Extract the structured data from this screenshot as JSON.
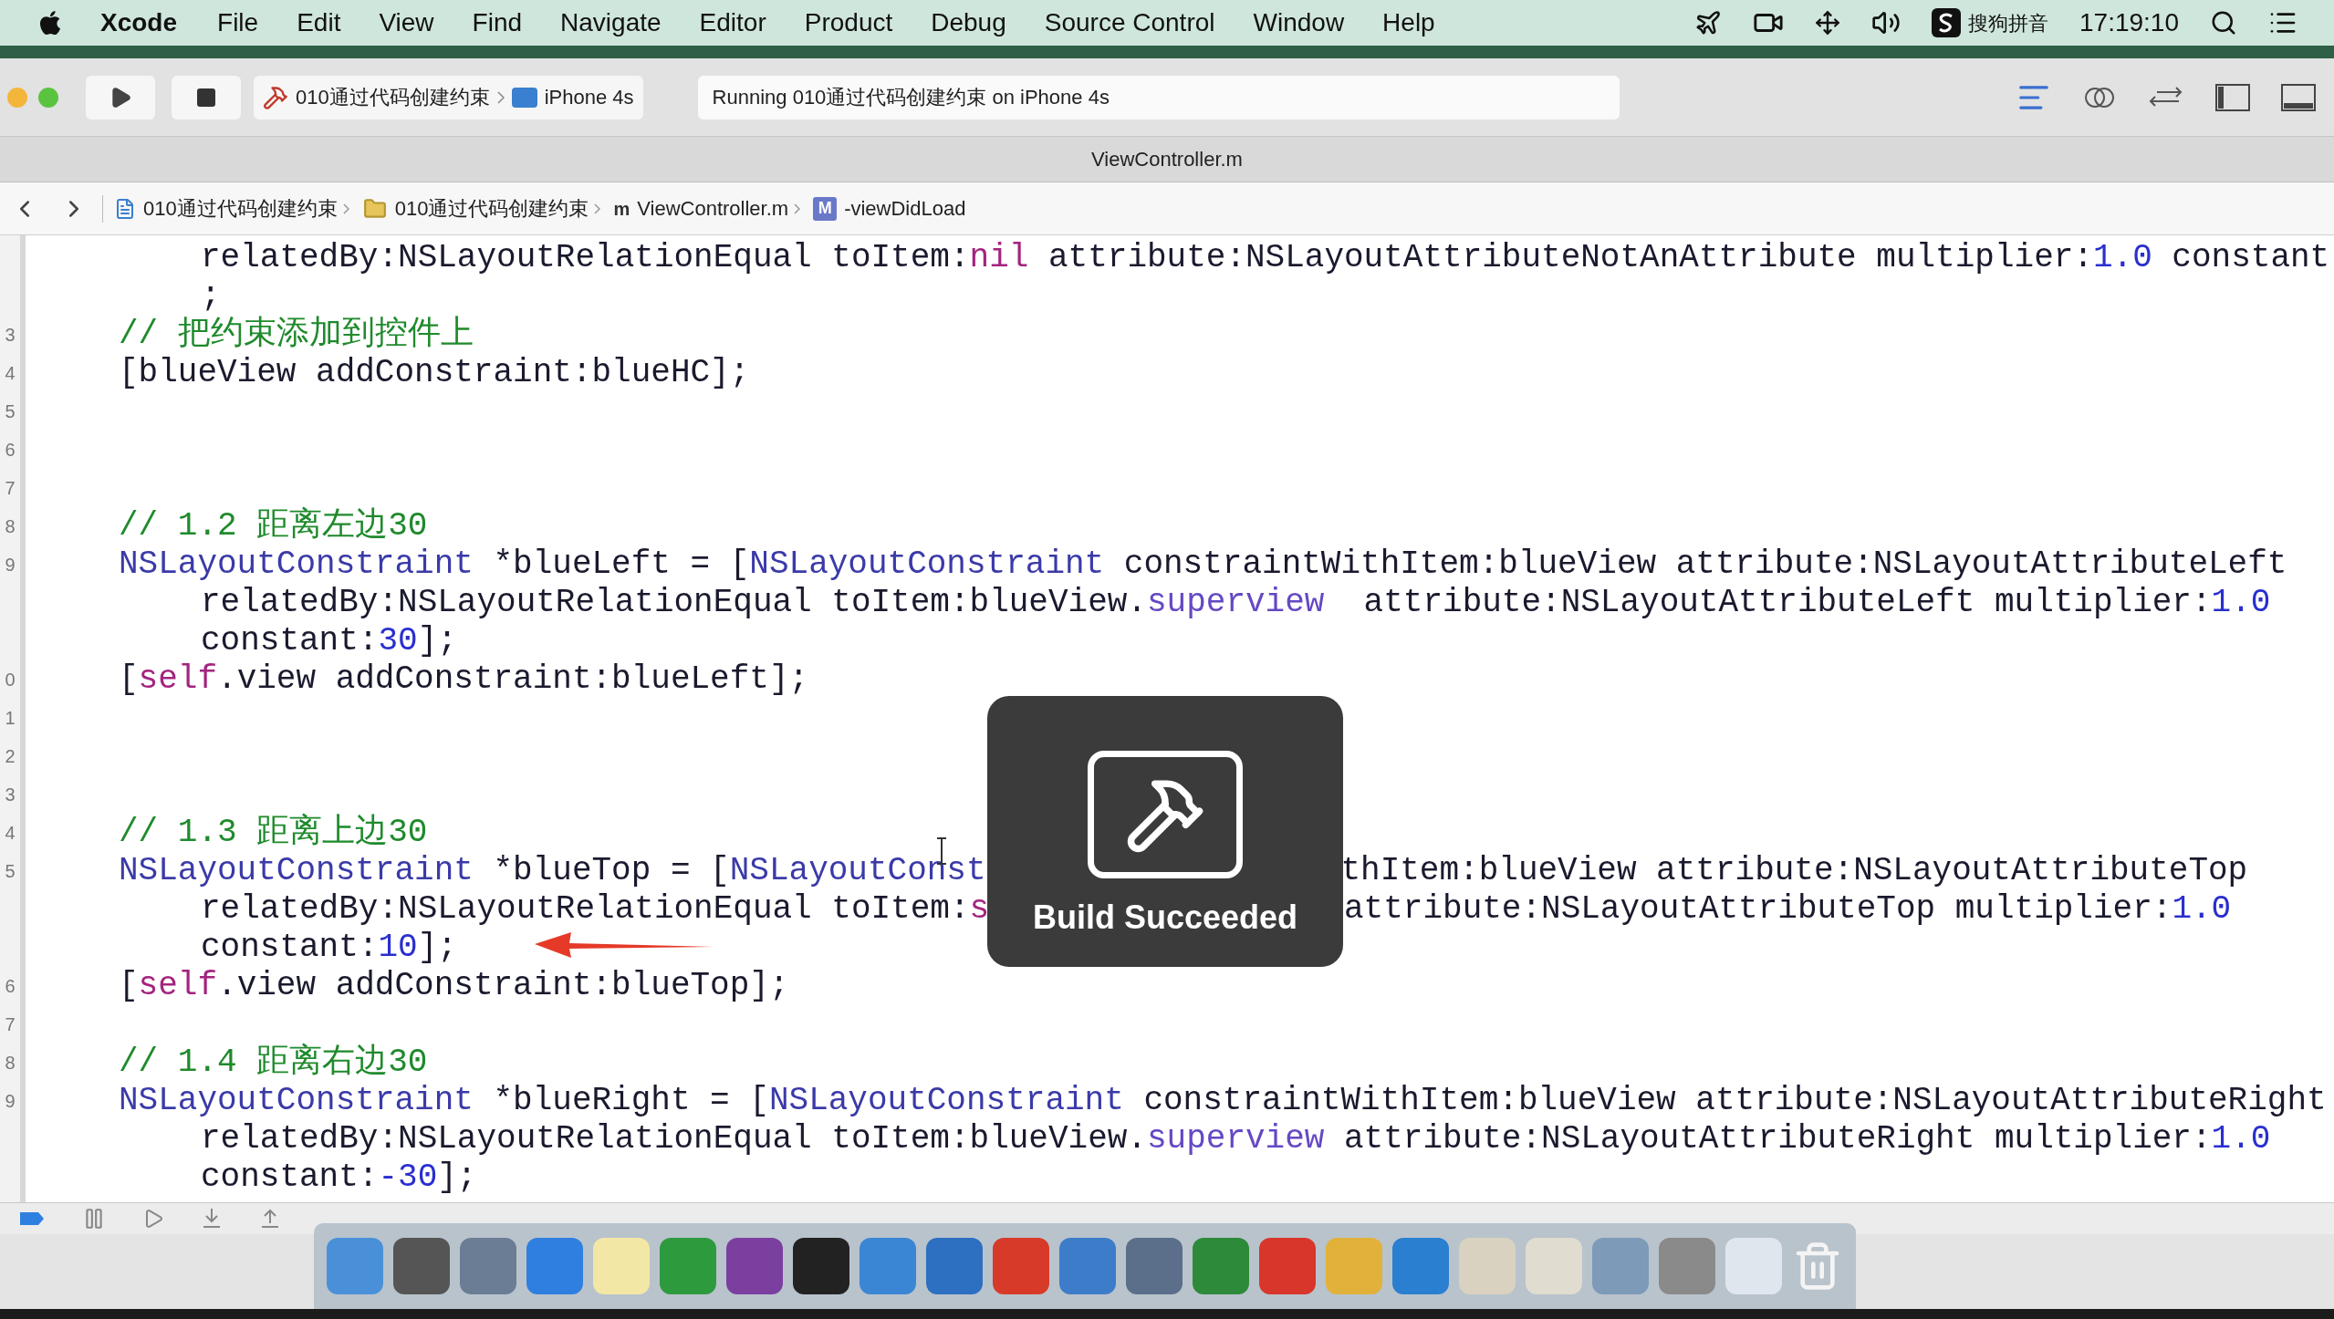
{
  "menu_bar": {
    "app": "Xcode",
    "items": [
      "File",
      "Edit",
      "View",
      "Find",
      "Navigate",
      "Editor",
      "Product",
      "Debug",
      "Source Control",
      "Window",
      "Help"
    ],
    "input_method": "搜狗拼音",
    "clock": "17:19:10"
  },
  "toolbar": {
    "scheme_project": "010通过代码创建约束",
    "scheme_device": "iPhone 4s",
    "activity": "Running 010通过代码创建约束 on iPhone 4s"
  },
  "tab": {
    "title": "ViewController.m"
  },
  "jump_bar": [
    {
      "kind": "project",
      "label": "010通过代码创建约束"
    },
    {
      "kind": "folder",
      "label": "010通过代码创建约束"
    },
    {
      "kind": "file",
      "badge": "m",
      "label": "ViewController.m"
    },
    {
      "kind": "method",
      "badge": "M",
      "label": "-viewDidLoad"
    }
  ],
  "editor": {
    "lines": [
      {
        "kind": "cont",
        "tokens": [
          {
            "kind": "plain",
            "t": "relatedBy:NSLayoutRelationEqual toItem:"
          },
          {
            "kind": "keyword",
            "t": "nil"
          },
          {
            "kind": "plain",
            "t": " attribute:NSLayoutAttributeNotAnAttribute multiplier:"
          },
          {
            "kind": "number",
            "t": "1.0"
          },
          {
            "kind": "plain",
            "t": " constant"
          }
        ]
      },
      {
        "kind": "cont",
        "tokens": [
          {
            "kind": "plain",
            "t": ";"
          }
        ]
      },
      {
        "kind": "stmt",
        "num": "3",
        "tokens": [
          {
            "kind": "comment",
            "t": "// 把约束添加到控件上"
          }
        ]
      },
      {
        "kind": "stmt",
        "num": "4",
        "tokens": [
          {
            "kind": "plain",
            "t": "[blueView addConstraint:blueHC];"
          }
        ]
      },
      {
        "kind": "blank",
        "num": "5"
      },
      {
        "kind": "blank",
        "num": "6"
      },
      {
        "kind": "blank",
        "num": "7"
      },
      {
        "kind": "stmt",
        "num": "8",
        "tokens": [
          {
            "kind": "comment",
            "t": "// 1.2 距离左边30"
          }
        ]
      },
      {
        "kind": "stmt",
        "num": "9",
        "tokens": [
          {
            "kind": "type",
            "t": "NSLayoutConstraint"
          },
          {
            "kind": "plain",
            "t": " *blueLeft = ["
          },
          {
            "kind": "type",
            "t": "NSLayoutConstraint"
          },
          {
            "kind": "plain",
            "t": " constraintWithItem:blueView attribute:NSLayoutAttributeLeft"
          }
        ]
      },
      {
        "kind": "cont",
        "tokens": [
          {
            "kind": "plain",
            "t": "relatedBy:NSLayoutRelationEqual toItem:blueView."
          },
          {
            "kind": "property",
            "t": "superview"
          },
          {
            "kind": "plain",
            "t": "  attribute:NSLayoutAttributeLeft multiplier:"
          },
          {
            "kind": "number",
            "t": "1.0"
          }
        ]
      },
      {
        "kind": "cont",
        "tokens": [
          {
            "kind": "plain",
            "t": "constant:"
          },
          {
            "kind": "number",
            "t": "30"
          },
          {
            "kind": "plain",
            "t": "];"
          }
        ]
      },
      {
        "kind": "stmt",
        "num": "0",
        "tokens": [
          {
            "kind": "plain",
            "t": "["
          },
          {
            "kind": "keyword",
            "t": "self"
          },
          {
            "kind": "plain",
            "t": ".view addConstraint:blueLeft];"
          }
        ]
      },
      {
        "kind": "blank",
        "num": "1"
      },
      {
        "kind": "blank",
        "num": "2"
      },
      {
        "kind": "blank",
        "num": "3"
      },
      {
        "kind": "stmt",
        "num": "4",
        "tokens": [
          {
            "kind": "comment",
            "t": "// 1.3 距离上边30"
          }
        ]
      },
      {
        "kind": "stmt",
        "num": "5",
        "tokens": [
          {
            "kind": "type",
            "t": "NSLayoutConstraint"
          },
          {
            "kind": "plain",
            "t": " *blueTop = ["
          },
          {
            "kind": "type",
            "t": "NSLayoutConst"
          }
        ],
        "after": [
          {
            "kind": "plain",
            "t": "thItem:blueView attribute:NSLayoutAttributeTop"
          }
        ]
      },
      {
        "kind": "cont",
        "tokens": [
          {
            "kind": "plain",
            "t": "relatedBy:NSLayoutRelationEqual toItem:"
          },
          {
            "kind": "keyword",
            "t": "s"
          }
        ],
        "after": [
          {
            "kind": "plain",
            "t": "attribute:NSLayoutAttributeTop multiplier:"
          },
          {
            "kind": "number",
            "t": "1.0"
          }
        ]
      },
      {
        "kind": "cont",
        "tokens": [
          {
            "kind": "plain",
            "t": "constant:"
          },
          {
            "kind": "number",
            "t": "10"
          },
          {
            "kind": "plain",
            "t": "];"
          }
        ]
      },
      {
        "kind": "stmt",
        "num": "6",
        "tokens": [
          {
            "kind": "plain",
            "t": "["
          },
          {
            "kind": "keyword",
            "t": "self"
          },
          {
            "kind": "plain",
            "t": ".view addConstraint:blueTop];"
          }
        ]
      },
      {
        "kind": "blank",
        "num": "7"
      },
      {
        "kind": "stmt",
        "num": "8",
        "tokens": [
          {
            "kind": "comment",
            "t": "// 1.4 距离右边30"
          }
        ]
      },
      {
        "kind": "stmt",
        "num": "9",
        "tokens": [
          {
            "kind": "type",
            "t": "NSLayoutConstraint"
          },
          {
            "kind": "plain",
            "t": " *blueRight = ["
          },
          {
            "kind": "type",
            "t": "NSLayoutConstraint"
          },
          {
            "kind": "plain",
            "t": " constraintWithItem:blueView attribute:NSLayoutAttributeRight"
          }
        ]
      },
      {
        "kind": "cont",
        "tokens": [
          {
            "kind": "plain",
            "t": "relatedBy:NSLayoutRelationEqual toItem:blueView."
          },
          {
            "kind": "property",
            "t": "superview"
          },
          {
            "kind": "plain",
            "t": " attribute:NSLayoutAttributeRight multiplier:"
          },
          {
            "kind": "number",
            "t": "1.0"
          }
        ]
      },
      {
        "kind": "cont",
        "tokens": [
          {
            "kind": "plain",
            "t": "constant:"
          },
          {
            "kind": "number",
            "t": "-30"
          },
          {
            "kind": "plain",
            "t": "];"
          }
        ]
      }
    ]
  },
  "toast": {
    "title": "Build Succeeded"
  }
}
